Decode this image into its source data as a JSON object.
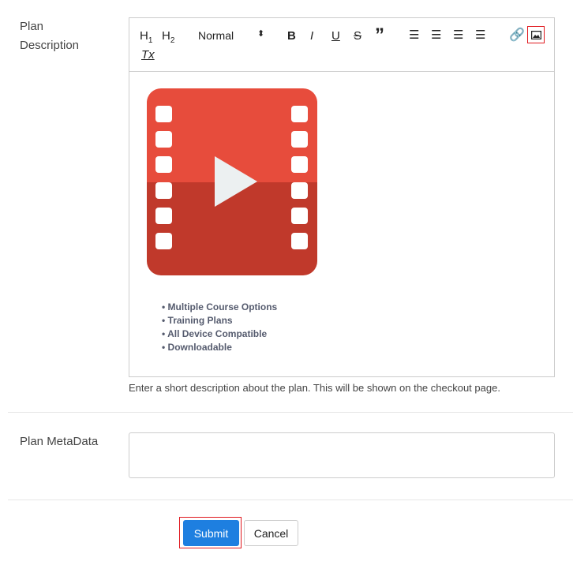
{
  "fields": {
    "description_label_1": "Plan",
    "description_label_2": "Description",
    "metadata_label": "Plan MetaData"
  },
  "toolbar": {
    "h1": "H1",
    "h2": "H2",
    "format": "Normal",
    "bold": "B",
    "italic": "I",
    "underline": "U",
    "strike": "S",
    "quote": "”",
    "clear": "Tx"
  },
  "content": {
    "bullets": [
      "Multiple Course Options",
      "Training Plans",
      "All Device Compatible",
      "Downloadable"
    ]
  },
  "help_text": "Enter a short description about the plan. This will be shown on the checkout page.",
  "buttons": {
    "submit": "Submit",
    "cancel": "Cancel"
  },
  "colors": {
    "accent": "#1e7fe0",
    "highlight": "#e0191f",
    "video_top": "#e74c3c",
    "video_bottom": "#c0392b"
  }
}
